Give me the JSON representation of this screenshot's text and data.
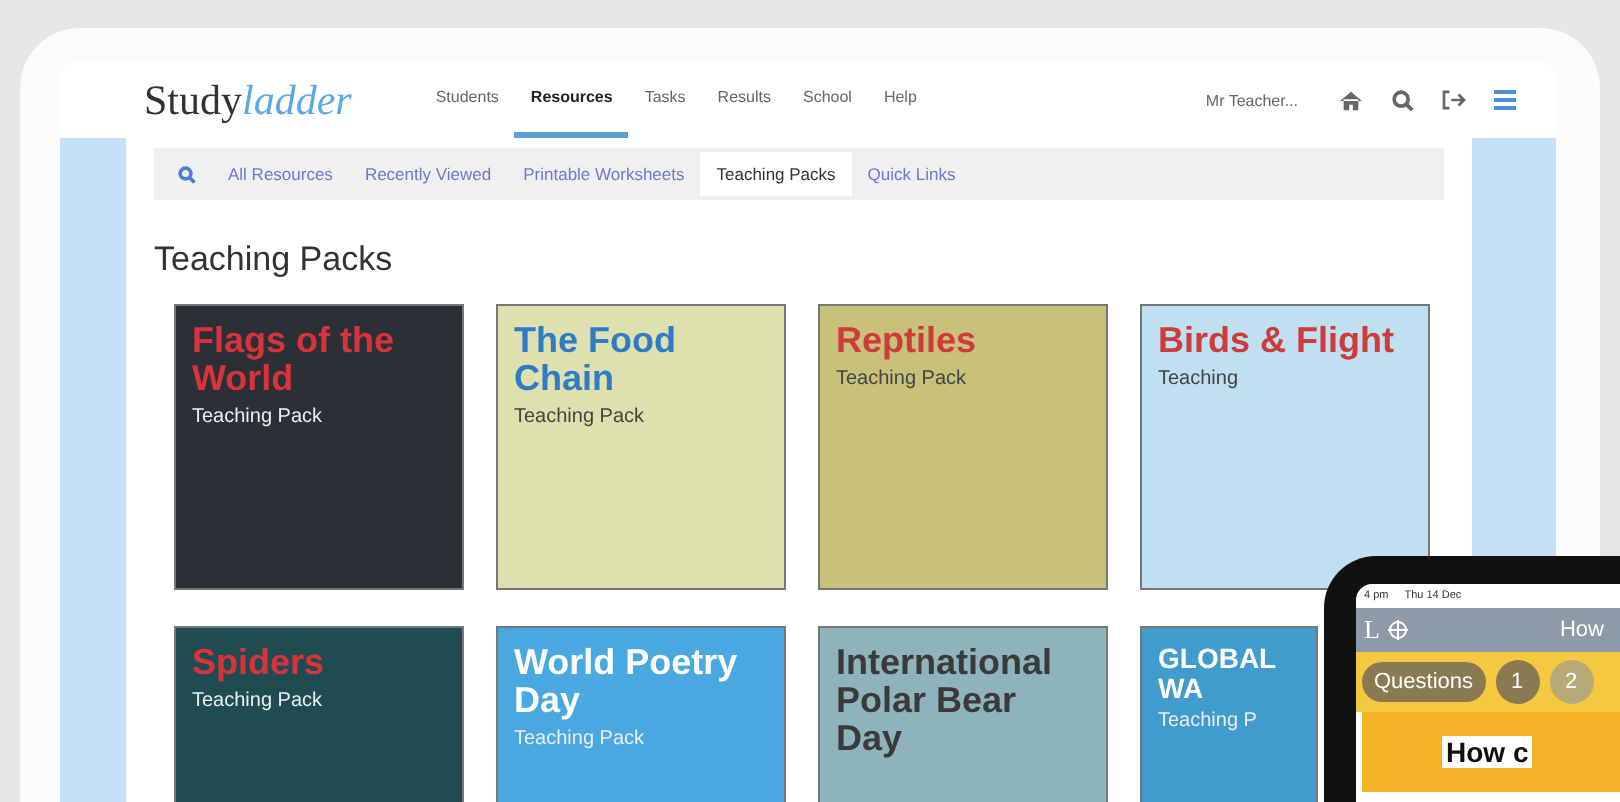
{
  "header": {
    "logo": {
      "main": "Study",
      "accent": "ladder"
    },
    "nav": [
      {
        "label": "Students",
        "selected": false
      },
      {
        "label": "Resources",
        "selected": true
      },
      {
        "label": "Tasks",
        "selected": false
      },
      {
        "label": "Results",
        "selected": false
      },
      {
        "label": "School",
        "selected": false
      },
      {
        "label": "Help",
        "selected": false
      }
    ],
    "user": "Mr Teacher..."
  },
  "subnav": [
    {
      "label": "All Resources",
      "selected": false
    },
    {
      "label": "Recently Viewed",
      "selected": false
    },
    {
      "label": "Printable Worksheets",
      "selected": false
    },
    {
      "label": "Teaching Packs",
      "selected": true
    },
    {
      "label": "Quick Links",
      "selected": false
    }
  ],
  "heading": "Teaching Packs",
  "cards": [
    {
      "title": {
        "text": "Flags of the World",
        "color": "#d8333a"
      },
      "subtitle": "Teaching Pack",
      "color": "#2b2f36"
    },
    {
      "title": {
        "text": "The Food Chain",
        "color": "#2f7cc4"
      },
      "subtitle": "Teaching Pack",
      "color": "#dfe0b0"
    },
    {
      "title": {
        "text": "Reptiles",
        "color": "#cf3a3a"
      },
      "subtitle": "Teaching Pack",
      "color": "#c9c07a"
    },
    {
      "title": {
        "text": "Birds & Flight",
        "color": "#cf3a3a"
      },
      "subtitle": "Teaching",
      "color": "#bfe0f0"
    },
    {
      "title": {
        "text": "Spiders",
        "color": "#d8333a"
      },
      "subtitle": "Teaching Pack",
      "color": "#1f4c52"
    },
    {
      "title": {
        "text": "World Poetry Day",
        "color": "#ffffff"
      },
      "subtitle": "Teaching Pack",
      "color": "#4aa8e0"
    },
    {
      "title": {
        "text": "International Polar Bear Day",
        "color": "#3a3a3a"
      },
      "color": "#8fb3bd"
    },
    {
      "title": {
        "text": "GLOBAL WA",
        "color": "#ffffff"
      },
      "subtitle": "Teaching P",
      "color": "#3f9ccc"
    }
  ],
  "phone": {
    "time": "4 pm",
    "date": "Thu 14 Dec",
    "app_letter": "L",
    "app_title": "How",
    "pills": [
      {
        "label": "Questions",
        "color": "#8a7a52"
      },
      {
        "label": "1",
        "color": "#8a7a52"
      },
      {
        "label": "2",
        "color": "#b8aa76"
      }
    ],
    "heading": "How c"
  }
}
